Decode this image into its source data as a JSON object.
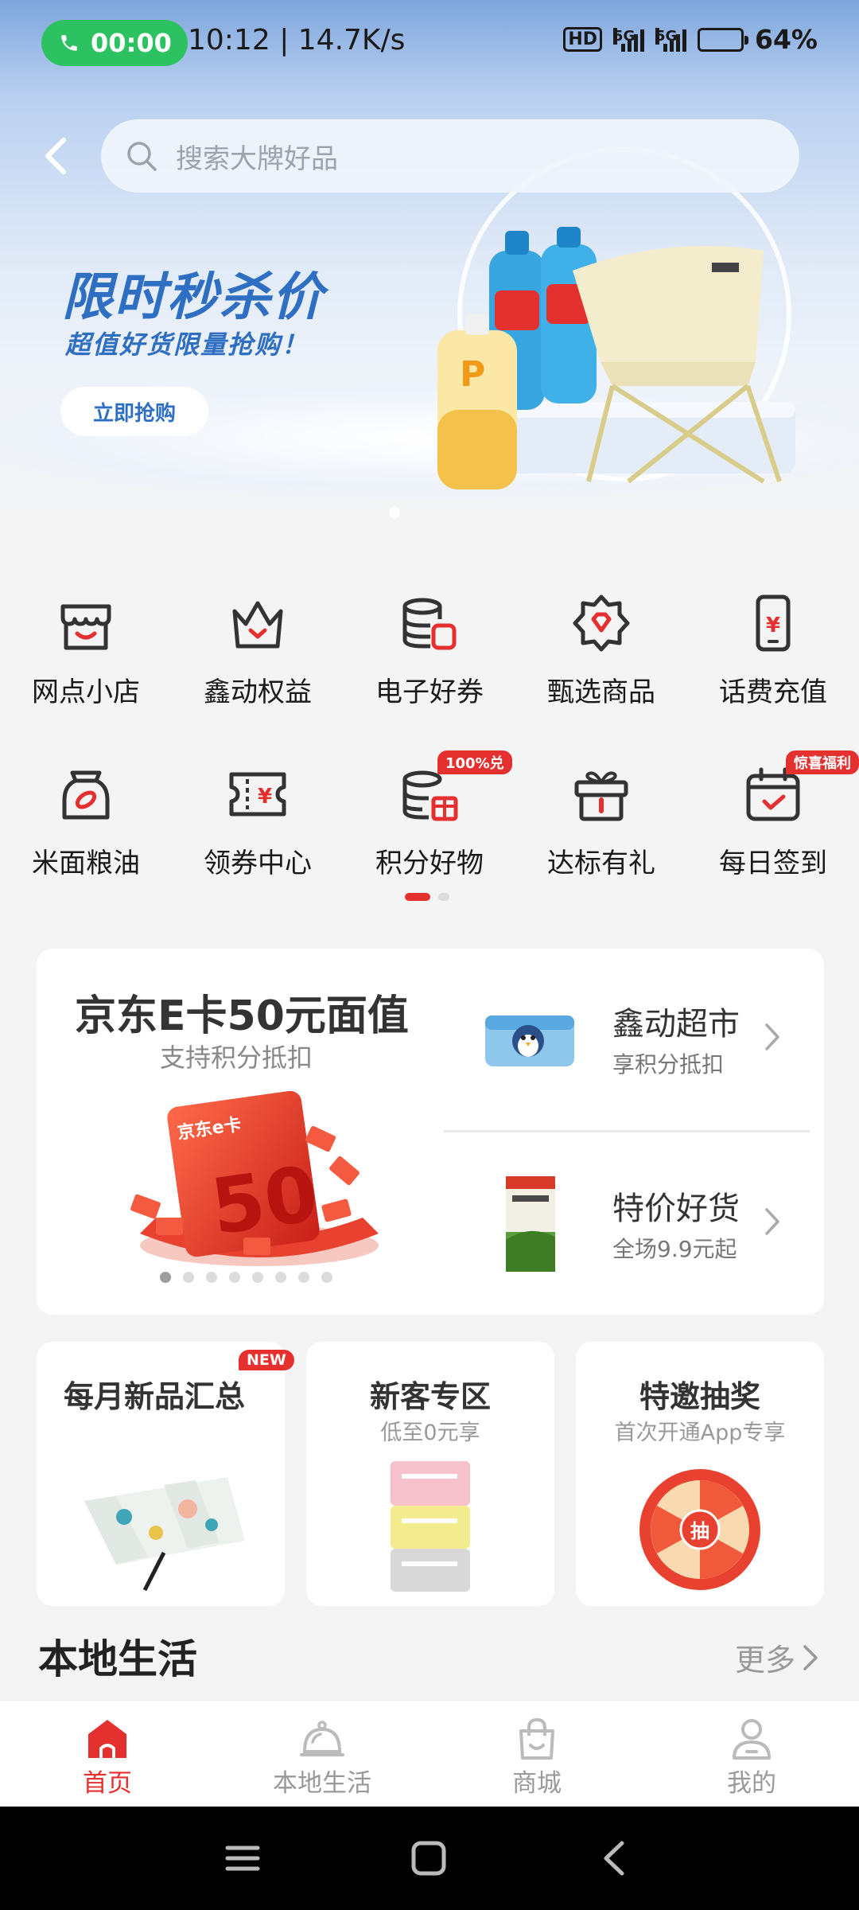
{
  "status_bar": {
    "call_time": "00:00",
    "time_speed": "10:12 | 14.7K/s",
    "hd": "HD",
    "net1": "5G",
    "net2": "5G",
    "battery": "64%"
  },
  "search": {
    "placeholder": "搜索大牌好品"
  },
  "banner": {
    "title": "限时秒杀价",
    "subtitle": "超值好货限量抢购！",
    "button": "立即抢购"
  },
  "quick_grid": {
    "row1": [
      {
        "label": "网点小店",
        "icon": "shop-icon"
      },
      {
        "label": "鑫动权益",
        "icon": "crown-icon"
      },
      {
        "label": "电子好券",
        "icon": "coin-coupon-icon"
      },
      {
        "label": "甄选商品",
        "icon": "diamond-badge-icon"
      },
      {
        "label": "话费充值",
        "icon": "phone-recharge-icon"
      }
    ],
    "row2": [
      {
        "label": "米面粮油",
        "icon": "rice-bag-icon"
      },
      {
        "label": "领券中心",
        "icon": "ticket-icon"
      },
      {
        "label": "积分好物",
        "icon": "points-gift-icon",
        "badge": "100%兑"
      },
      {
        "label": "达标有礼",
        "icon": "gift-box-icon"
      },
      {
        "label": "每日签到",
        "icon": "calendar-check-icon",
        "badge": "惊喜福利"
      }
    ]
  },
  "ecard": {
    "title": "京东E卡50元面值",
    "subtitle": "支持积分抵扣",
    "card_text": "京东e卡",
    "card_value": "50"
  },
  "side_entries": [
    {
      "title": "鑫动超市",
      "subtitle": "享积分抵扣"
    },
    {
      "title": "特价好货",
      "subtitle": "全场9.9元起"
    }
  ],
  "small_cards": [
    {
      "title": "每月新品汇总",
      "subtitle": "",
      "badge": "NEW"
    },
    {
      "title": "新客专区",
      "subtitle": "低至0元享"
    },
    {
      "title": "特邀抽奖",
      "subtitle": "首次开通App专享",
      "wheel_text": "抽"
    }
  ],
  "local_life": {
    "title": "本地生活",
    "more": "更多"
  },
  "tabs": [
    {
      "label": "首页",
      "active": true
    },
    {
      "label": "本地生活",
      "active": false
    },
    {
      "label": "商城",
      "active": false
    },
    {
      "label": "我的",
      "active": false
    }
  ],
  "colors": {
    "brand_red": "#e53030",
    "banner_blue": "#2f6fc3",
    "call_green": "#2dc261"
  }
}
